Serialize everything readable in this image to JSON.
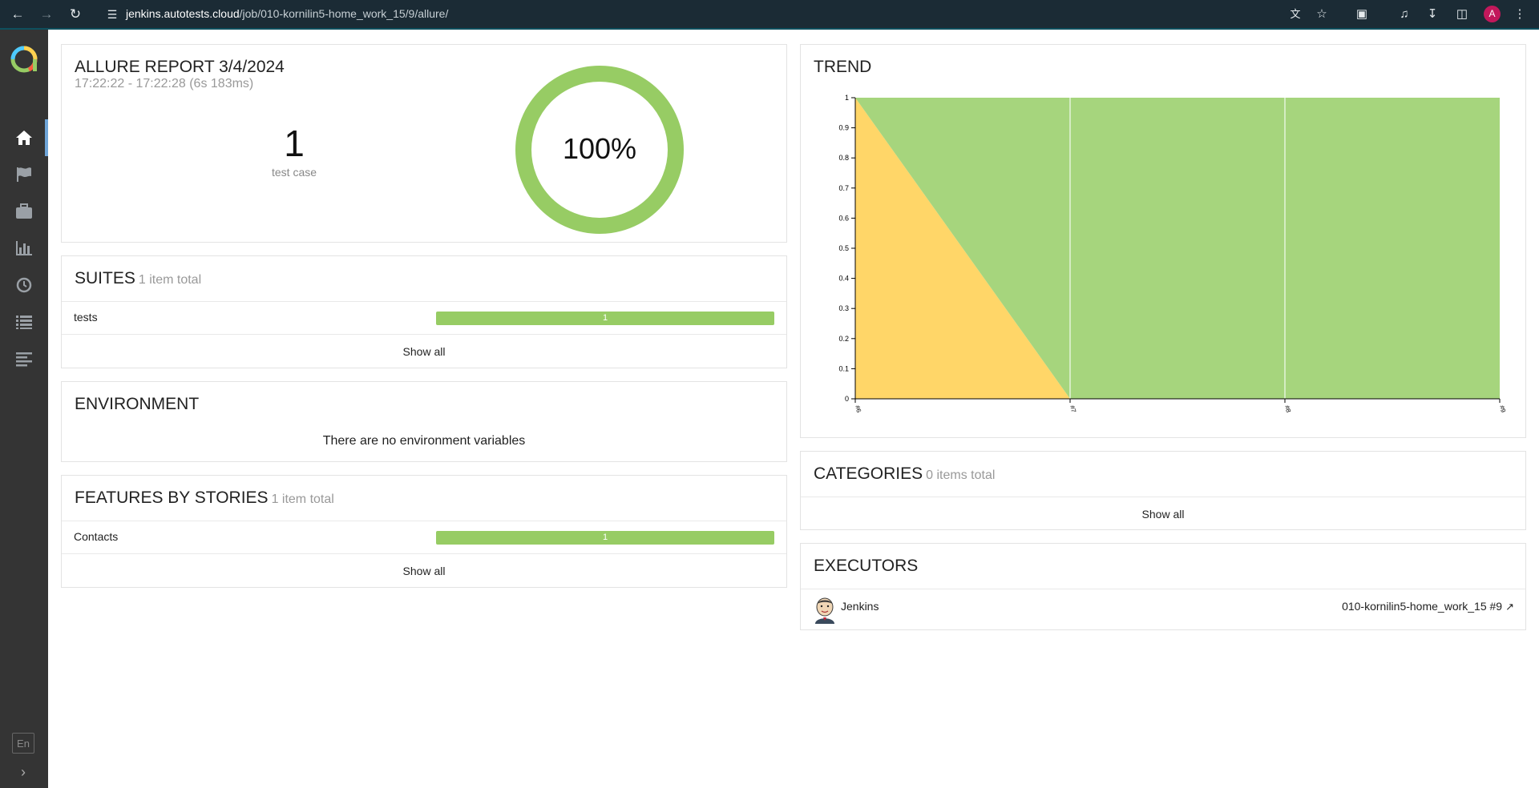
{
  "browser": {
    "url_host": "jenkins.autotests.cloud",
    "url_path": "/job/010-kornilin5-home_work_15/9/allure/",
    "profile_initial": "A"
  },
  "sidebar": {
    "items": [
      {
        "icon": "home-icon",
        "active": true
      },
      {
        "icon": "flag-icon",
        "active": false
      },
      {
        "icon": "briefcase-icon",
        "active": false
      },
      {
        "icon": "bar-chart-icon",
        "active": false
      },
      {
        "icon": "clock-icon",
        "active": false
      },
      {
        "icon": "list-icon",
        "active": false
      },
      {
        "icon": "timeline-icon",
        "active": false
      }
    ],
    "language": "En"
  },
  "summary": {
    "title": "ALLURE REPORT 3/4/2024",
    "time_range": "17:22:22 - 17:22:28 (6s 183ms)",
    "test_count": "1",
    "test_count_label": "test case",
    "percent_label": "100%",
    "passed_fraction": 1.0
  },
  "suites": {
    "title": "SUITES",
    "total": "1 item total",
    "rows": [
      {
        "name": "tests",
        "count": "1"
      }
    ],
    "show_all": "Show all"
  },
  "environment": {
    "title": "ENVIRONMENT",
    "empty_text": "There are no environment variables"
  },
  "features": {
    "title": "FEATURES BY STORIES",
    "total": "1 item total",
    "rows": [
      {
        "name": "Contacts",
        "count": "1"
      }
    ],
    "show_all": "Show all"
  },
  "trend": {
    "title": "TREND"
  },
  "chart_data": {
    "type": "area",
    "x": [
      "#6",
      "#7",
      "#8",
      "#9"
    ],
    "series": [
      {
        "color": "#ffd668",
        "values": [
          1,
          0,
          0,
          0
        ]
      },
      {
        "color": "#a6d57d",
        "values": [
          0,
          1,
          1,
          1
        ]
      }
    ],
    "y_ticks": [
      "0",
      "0.1",
      "0.2",
      "0.3",
      "0.4",
      "0.5",
      "0.6",
      "0.7",
      "0.8",
      "0.9",
      "1"
    ],
    "ylim": [
      0,
      1
    ],
    "stacked": true
  },
  "categories": {
    "title": "CATEGORIES",
    "total": "0 items total",
    "show_all": "Show all"
  },
  "executors": {
    "title": "EXECUTORS",
    "name": "Jenkins",
    "build": "010-kornilin5-home_work_15 #9"
  }
}
